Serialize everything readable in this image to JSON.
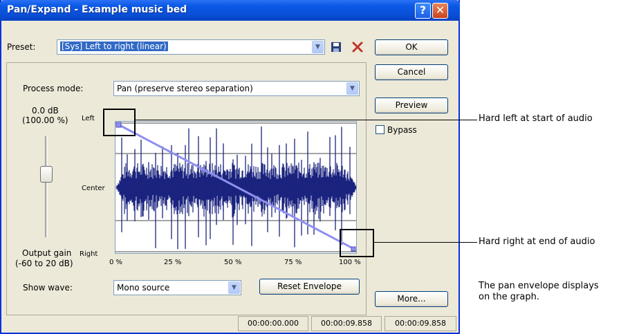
{
  "window": {
    "title": "Pan/Expand - Example music bed"
  },
  "preset": {
    "label": "Preset:",
    "value": "[Sys] Left to right (linear)"
  },
  "process_mode": {
    "label": "Process mode:",
    "value": "Pan (preserve stereo separation)"
  },
  "gain": {
    "value_db": "0.0 dB",
    "value_pct": "(100.00 %)",
    "label": "Output gain",
    "range": "(-60 to 20 dB)"
  },
  "graph": {
    "y_labels": {
      "left": "Left",
      "center": "Center",
      "right": "Right"
    },
    "x_ticks": [
      "0 %",
      "25 %",
      "50 %",
      "75 %",
      "100 %"
    ]
  },
  "show_wave": {
    "label": "Show wave:",
    "value": "Mono source"
  },
  "buttons": {
    "ok": "OK",
    "cancel": "Cancel",
    "preview": "Preview",
    "bypass": "Bypass",
    "reset_envelope": "Reset Envelope",
    "more": "More..."
  },
  "status_bar": [
    "00:00:00.000",
    "00:00:09.858",
    "00:00:09.858"
  ],
  "callouts": {
    "hard_left": "Hard left at start of audio",
    "hard_right": "Hard right at end of audio",
    "caption_line1": "The pan envelope displays",
    "caption_line2": "on the graph."
  },
  "colors": {
    "titlebar": "#0a4fd6",
    "waveform": "#1a237e",
    "envelope": "#8f8ff0"
  }
}
